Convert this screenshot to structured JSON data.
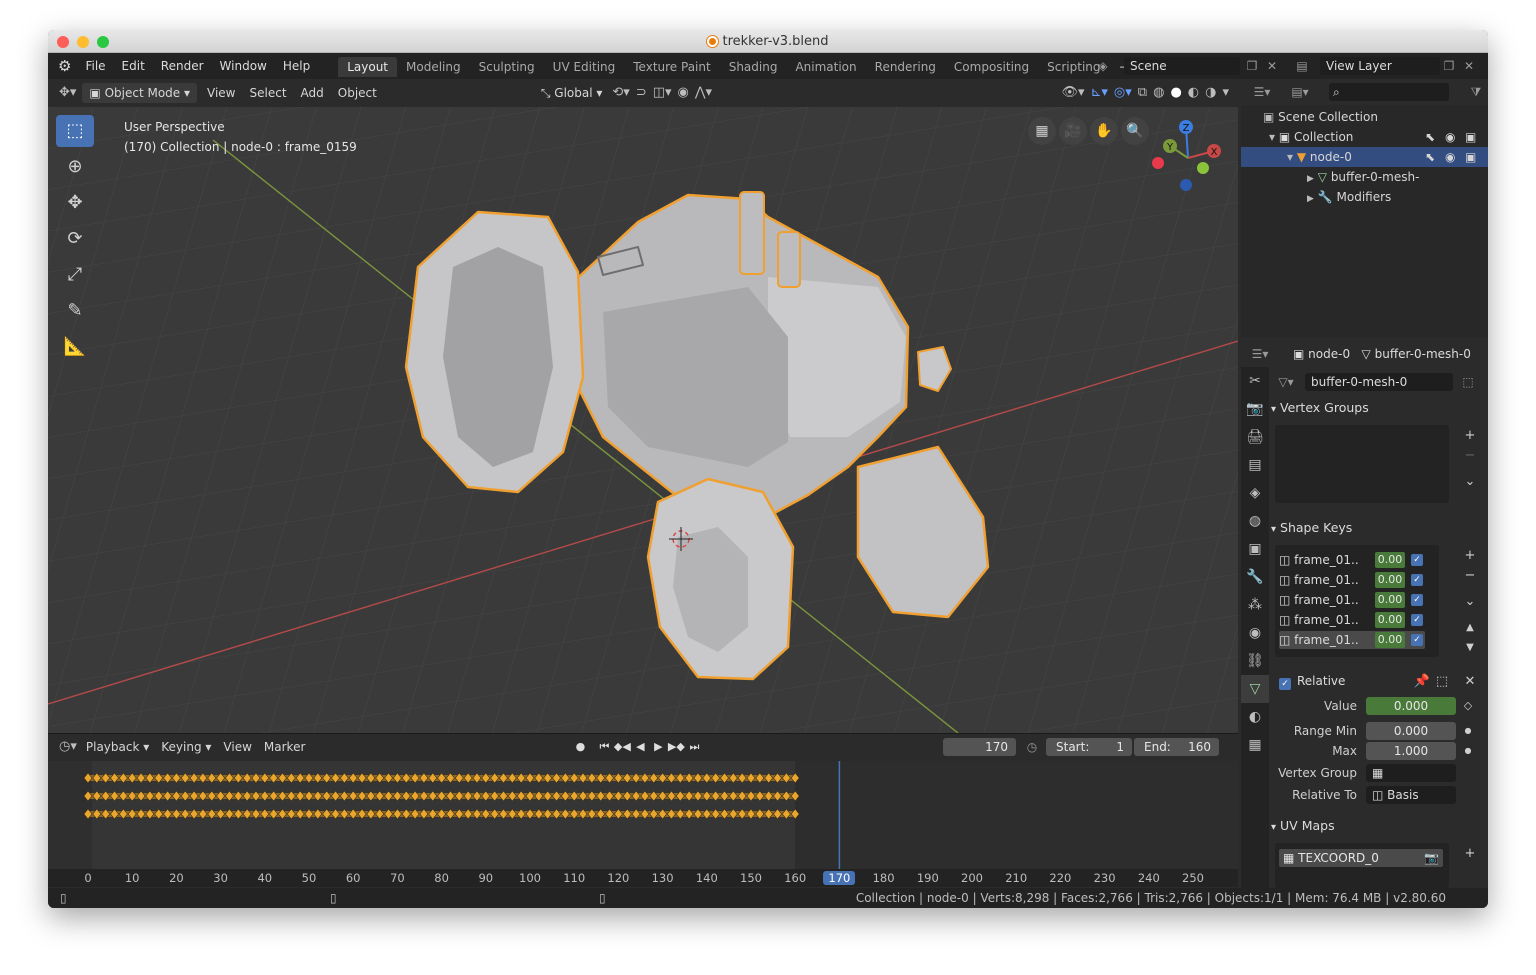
{
  "window": {
    "title": "trekker-v3.blend"
  },
  "menu": [
    "File",
    "Edit",
    "Render",
    "Window",
    "Help"
  ],
  "workspaces": [
    {
      "label": "Layout",
      "active": true
    },
    {
      "label": "Modeling"
    },
    {
      "label": "Sculpting"
    },
    {
      "label": "UV Editing"
    },
    {
      "label": "Texture Paint"
    },
    {
      "label": "Shading"
    },
    {
      "label": "Animation"
    },
    {
      "label": "Rendering"
    },
    {
      "label": "Compositing"
    },
    {
      "label": "Scripting"
    }
  ],
  "scene": {
    "name": "Scene",
    "view_layer": "View Layer"
  },
  "viewport_header": {
    "mode": "Object Mode",
    "menus": [
      "View",
      "Select",
      "Add",
      "Object"
    ],
    "transform_orientation": "Global"
  },
  "viewport": {
    "info_line1": "User Perspective",
    "info_line2": "(170) Collection | node-0 : frame_0159",
    "gizmo": {
      "x": "X",
      "y": "Y",
      "z": "Z"
    }
  },
  "timeline": {
    "menus": [
      "Playback",
      "Keying",
      "View",
      "Marker"
    ],
    "current_frame": "170",
    "start_label": "Start:",
    "start": "1",
    "end_label": "End:",
    "end": "160",
    "ruler_ticks": [
      "0",
      "10",
      "20",
      "30",
      "40",
      "50",
      "60",
      "70",
      "80",
      "90",
      "100",
      "110",
      "120",
      "130",
      "140",
      "150",
      "160",
      "170",
      "180",
      "190",
      "200",
      "210",
      "220",
      "230",
      "240",
      "250"
    ],
    "keyframe_rows": 3,
    "keyframe_end_frame": 160
  },
  "outliner": {
    "search_placeholder": "",
    "rows": [
      {
        "label": "Scene Collection"
      },
      {
        "label": "Collection"
      },
      {
        "label": "node-0"
      },
      {
        "label": "buffer-0-mesh-"
      },
      {
        "label": "Modifiers"
      }
    ]
  },
  "properties": {
    "breadcrumb_object": "node-0",
    "breadcrumb_mesh": "buffer-0-mesh-0",
    "mesh_name": "buffer-0-mesh-0",
    "vertex_groups_title": "Vertex Groups",
    "shape_keys_title": "Shape Keys",
    "shape_keys": [
      {
        "name": "frame_01..",
        "value": "0.00"
      },
      {
        "name": "frame_01..",
        "value": "0.00"
      },
      {
        "name": "frame_01..",
        "value": "0.00"
      },
      {
        "name": "frame_01..",
        "value": "0.00"
      },
      {
        "name": "frame_01..",
        "value": "0.00"
      }
    ],
    "relative_label": "Relative",
    "value_label": "Value",
    "value": "0.000",
    "range_min_label": "Range Min",
    "range_min": "0.000",
    "max_label": "Max",
    "max": "1.000",
    "vertex_group_label": "Vertex Group",
    "relative_to_label": "Relative To",
    "relative_to": "Basis",
    "uv_maps_title": "UV Maps",
    "uv_map": "TEXCOORD_0"
  },
  "statusbar": {
    "text": "Collection | node-0 | Verts:8,298 | Faces:2,766 | Tris:2,766 | Objects:1/1 | Mem: 76.4 MB | v2.80.60"
  },
  "colors": {
    "accent": "#4772b3",
    "selection_outline": "#f0a030",
    "keyframe": "#e8a530",
    "active_frame": "#4772b3",
    "x_axis": "#c84848",
    "y_axis": "#7a9a3a"
  }
}
